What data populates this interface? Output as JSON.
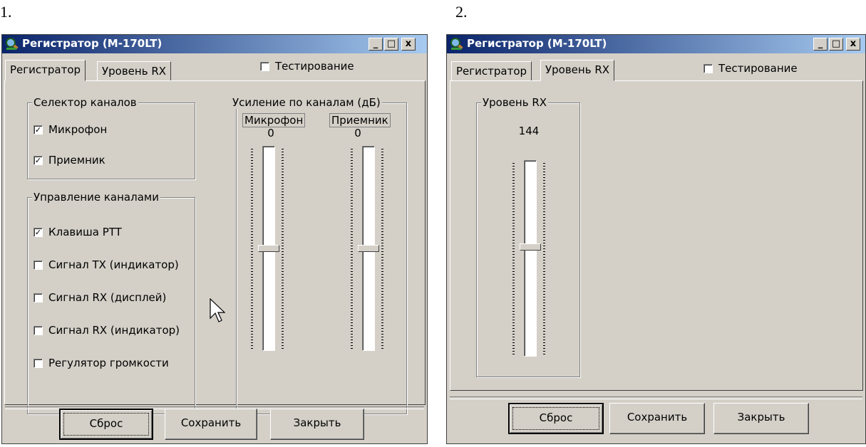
{
  "captions": [
    "1.",
    "2."
  ],
  "windows": [
    {
      "title": "Регистратор (М-170LT)",
      "controls": {
        "minimize": "_",
        "maximize": "□",
        "close": "x"
      },
      "tabs": [
        {
          "label": "Регистратор",
          "active": true
        },
        {
          "label": "Уровень RX",
          "active": false
        }
      ],
      "testing": {
        "label": "Тестирование",
        "checked": false
      },
      "channel_selector": {
        "title": "Селектор каналов",
        "items": [
          {
            "label": "Микрофон",
            "checked": true
          },
          {
            "label": "Приемник",
            "checked": true
          }
        ]
      },
      "channel_control": {
        "title": "Управление каналами",
        "items": [
          {
            "label": "Клавиша PTT",
            "checked": true
          },
          {
            "label": "Сигнал TX (индикатор)",
            "checked": false
          },
          {
            "label": "Сигнал RX (дисплей)",
            "checked": false
          },
          {
            "label": "Сигнал RX (индикатор)",
            "checked": false
          },
          {
            "label": "Регулятор громкости",
            "checked": false
          }
        ]
      },
      "gain": {
        "title": "Усиление по каналам (дБ)",
        "channels": [
          {
            "label": "Микрофон",
            "value": "0",
            "level": 0.5
          },
          {
            "label": "Приемник",
            "value": "0",
            "level": 0.5
          }
        ]
      },
      "buttons": {
        "reset": "Сброс",
        "save": "Сохранить",
        "close": "Закрыть"
      }
    },
    {
      "title": "Регистратор (М-170LT)",
      "controls": {
        "minimize": "_",
        "maximize": "□",
        "close": "x"
      },
      "tabs": [
        {
          "label": "Регистратор",
          "active": false
        },
        {
          "label": "Уровень RX",
          "active": true
        }
      ],
      "testing": {
        "label": "Тестирование",
        "checked": false
      },
      "rx_level": {
        "title": "Уровень RX",
        "value": "144",
        "level": 0.56
      },
      "buttons": {
        "reset": "Сброс",
        "save": "Сохранить",
        "close": "Закрыть"
      }
    }
  ],
  "colors": {
    "face": "#d4d0c8",
    "title_start": "#0a246a",
    "title_end": "#a6caf0",
    "shadow": "#808080"
  },
  "icons": {
    "app": "magnifier-icon",
    "cursor": "mouse-pointer-icon"
  }
}
